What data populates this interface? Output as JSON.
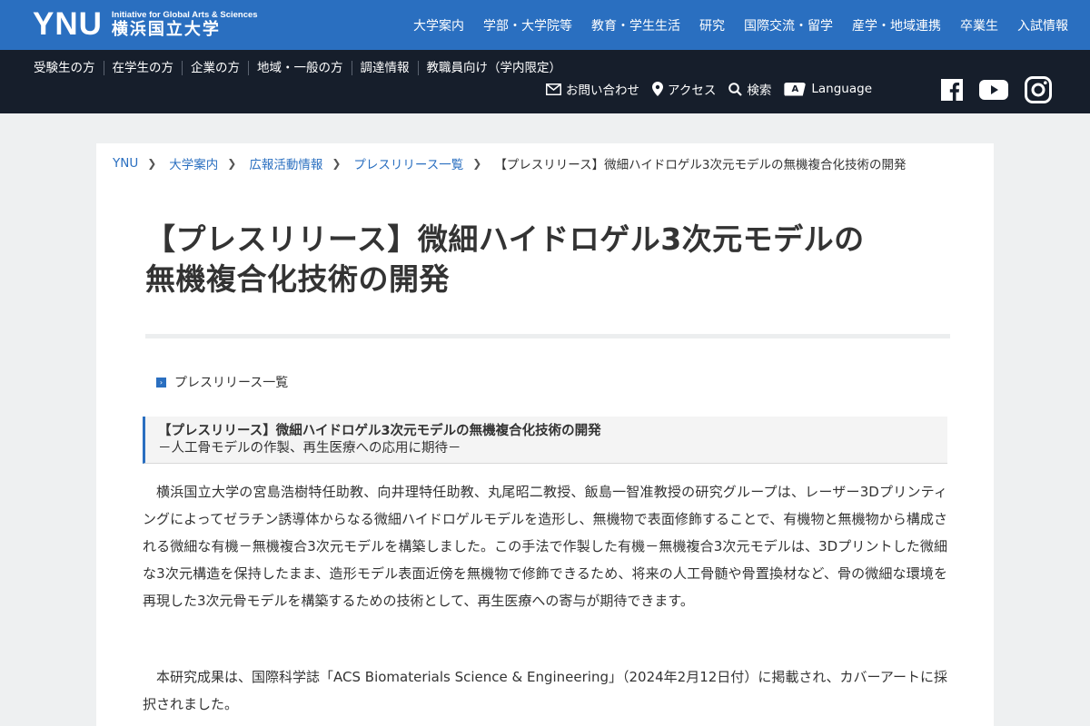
{
  "header": {
    "logo_mark": "YNU",
    "logo_sub": "Initiative for Global Arts & Sciences",
    "logo_jp": "横浜国立大学",
    "nav": [
      "大学案内",
      "学部・大学院等",
      "教育・学生生活",
      "研究",
      "国際交流・留学",
      "産学・地域連携",
      "卒業生",
      "入試情報"
    ]
  },
  "subbar": {
    "nav": [
      "受験生の方",
      "在学生の方",
      "企業の方",
      "地域・一般の方",
      "調達情報",
      "教職員向け（学内限定）"
    ],
    "util": {
      "contact": "お問い合わせ",
      "access": "アクセス",
      "search": "検索",
      "lang_badge": "A",
      "language": "Language"
    },
    "social": [
      "facebook-icon",
      "youtube-icon",
      "instagram-icon"
    ]
  },
  "breadcrumb": {
    "items": [
      "YNU",
      "大学案内",
      "広報活動情報",
      "プレスリリース一覧"
    ],
    "current": "【プレスリリース】微細ハイドロゲル3次元モデルの無機複合化技術の開発"
  },
  "article": {
    "title_line1": "【プレスリリース】微細ハイドロゲル3次元モデルの",
    "title_line2": "無機複合化技術の開発",
    "list_link": "プレスリリース一覧",
    "box_heading": "【プレスリリース】微細ハイドロゲル3次元モデルの無機複合化技術の開発",
    "box_sub": "－人工骨モデルの作製、再生医療への応用に期待－",
    "paragraph1": "横浜国立大学の宮島浩樹特任助教、向井理特任助教、丸尾昭二教授、飯島一智准教授の研究グループは、レーザー3Dプリンティングによってゼラチン誘導体からなる微細ハイドロゲルモデルを造形し、無機物で表面修飾することで、有機物と無機物から構成される微細な有機－無機複合3次元モデルを構築しました。この手法で作製した有機－無機複合3次元モデルは、3Dプリントした微細な3次元構造を保持したまま、造形モデル表面近傍を無機物で修飾できるため、将来の人工骨髄や骨置換材など、骨の微細な環境を再現した3次元骨モデルを構築するための技術として、再生医療への寄与が期待できます。",
    "paragraph2": "本研究成果は、国際科学誌「ACS Biomaterials Science & Engineering」（2024年2月12日付）に掲載され、カバーアートに採択されました。"
  },
  "colors": {
    "brand_blue": "#2a6fc0",
    "dark_bar": "#161e2b",
    "page_bg": "#eef0f1"
  }
}
